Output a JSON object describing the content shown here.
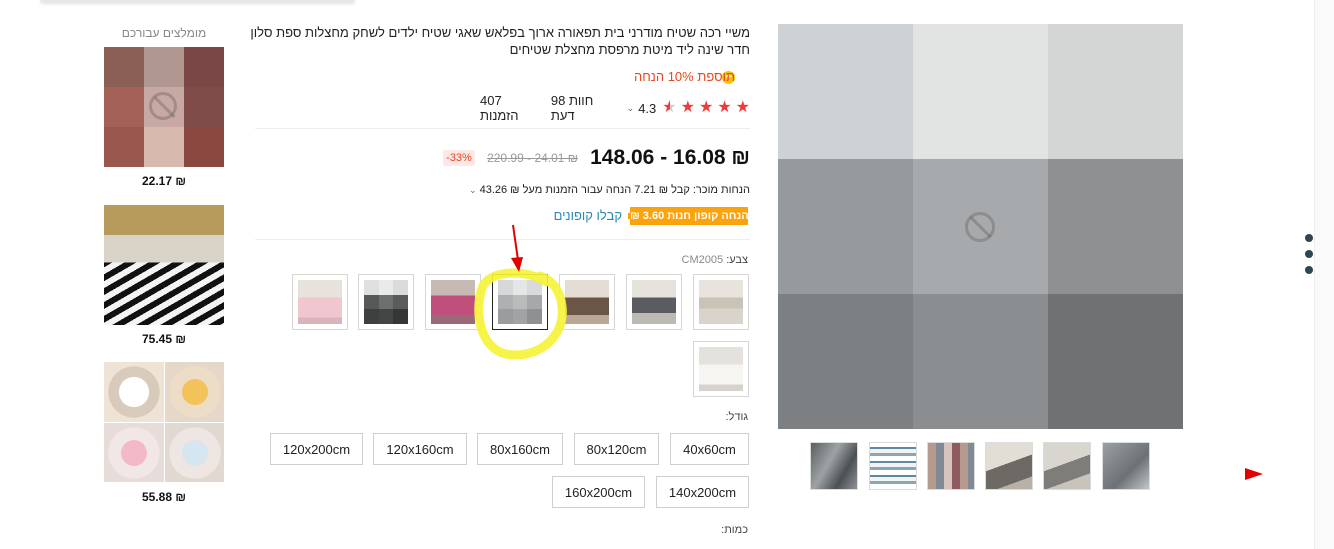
{
  "product": {
    "title": "משיי רכה שטיח מודרני בית תפאורה ארוך בפלאש שאגי שטיח ילדים לשחק מחצלות ספת סלון חדר שינה ליד מיטת מרפסת מחצלת שטיחים",
    "promo": "תוספת 10% הנחה",
    "promo_icon": "plus-circle-icon",
    "rating_value": "4.3",
    "reviews": "98 חוות דעת",
    "orders": "407 הזמנות",
    "stars_filled": 4.3
  },
  "pricing": {
    "current": "₪ 16.08 - 148.06",
    "original": "₪ 24.01 - 220.99",
    "discount": "-33%",
    "volume_discount": "הנחות מוכר: קבל ₪ 7.21 הנחה עבור הזמנות מעל ₪ 43.26",
    "coupon": "₪ 3.60 הנחה קופון חנות",
    "coupon_link": "קבלו קופונים"
  },
  "options": {
    "color_label": "צבע:",
    "color_value": "CM2005",
    "colors": [
      {
        "name": "beige-sofa"
      },
      {
        "name": "dark-gray-sofa"
      },
      {
        "name": "brown-sofa"
      },
      {
        "name": "gray-blur"
      },
      {
        "name": "pink-purple"
      },
      {
        "name": "dark-gray-blocks"
      },
      {
        "name": "pink-rug"
      },
      {
        "name": "white-rug"
      }
    ],
    "size_label": "גודל:",
    "sizes": [
      "40x60cm",
      "80x120cm",
      "80x160cm",
      "120x160cm",
      "120x200cm",
      "140x200cm",
      "160x200cm"
    ],
    "quantity_label": "כמות:"
  },
  "recommended": {
    "title": "מומלצים עבורכם",
    "items": [
      {
        "price": "₪ 22.17"
      },
      {
        "price": "₪ 75.45"
      },
      {
        "price": "₪ 55.88"
      }
    ]
  },
  "colors": {
    "accent_red": "#e8461d",
    "coupon_orange": "#fba30d",
    "link_blue": "#2a89b8",
    "highlight_yellow": "#f7f241",
    "star_red": "#f03939"
  }
}
